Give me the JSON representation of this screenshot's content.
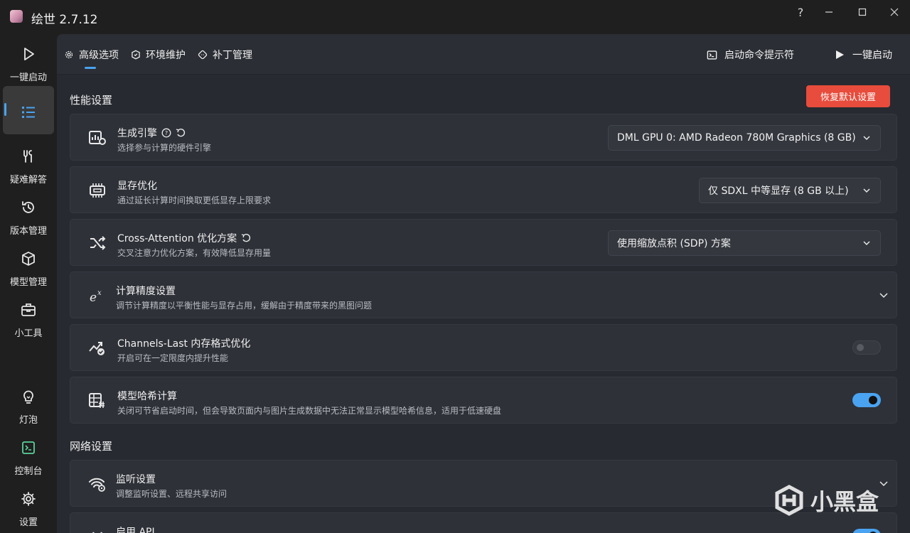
{
  "app": {
    "title": "绘世 2.7.12"
  },
  "window": {
    "help": "?"
  },
  "sidebar": {
    "items": [
      {
        "label": "一键启动",
        "icon": "play-icon"
      },
      {
        "label": "",
        "icon": "list-icon"
      },
      {
        "label": "疑难解答",
        "icon": "tools-icon"
      },
      {
        "label": "版本管理",
        "icon": "history-icon"
      },
      {
        "label": "模型管理",
        "icon": "cube-icon"
      },
      {
        "label": "小工具",
        "icon": "toolbox-icon"
      },
      {
        "label": "灯泡",
        "icon": "lightbulb-icon"
      },
      {
        "label": "控制台",
        "icon": "console-icon"
      },
      {
        "label": "设置",
        "icon": "gear-icon"
      }
    ]
  },
  "topbar": {
    "tabs": [
      {
        "label": "高级选项",
        "icon": "gear-icon"
      },
      {
        "label": "环境维护",
        "icon": "maintenance-icon"
      },
      {
        "label": "补丁管理",
        "icon": "patch-icon"
      }
    ],
    "console_label": "启动命令提示符",
    "launch_label": "一键启动"
  },
  "performance": {
    "title": "性能设置",
    "reset_label": "恢复默认设置",
    "cards": [
      {
        "title": "生成引擎",
        "desc": "选择参与计算的硬件引擎",
        "value": "DML GPU 0: AMD Radeon 780M Graphics (8 GB)"
      },
      {
        "title": "显存优化",
        "desc": "通过延长计算时间换取更低显存上限要求",
        "value": "仅 SDXL 中等显存 (8 GB 以上)"
      },
      {
        "title": "Cross-Attention 优化方案",
        "desc": "交叉注意力优化方案，有效降低显存用量",
        "value": "使用缩放点积 (SDP) 方案"
      },
      {
        "title": "计算精度设置",
        "desc": "调节计算精度以平衡性能与显存占用，缓解由于精度带来的黑图问题"
      },
      {
        "title": "Channels-Last 内存格式优化",
        "desc": "开启可在一定限度内提升性能",
        "toggle": false
      },
      {
        "title": "模型哈希计算",
        "desc": "关闭可节省启动时间，但会导致页面内与图片生成数据中无法正常显示模型哈希信息，适用于低速硬盘",
        "toggle": true
      }
    ]
  },
  "network": {
    "title": "网络设置",
    "cards": [
      {
        "title": "监听设置",
        "desc": "调整监听设置、远程共享访问"
      },
      {
        "title": "启用 API"
      }
    ]
  },
  "watermark": {
    "text": "小黑盒"
  },
  "colors": {
    "accent": "#4aa3f0",
    "danger": "#e74c3c"
  }
}
